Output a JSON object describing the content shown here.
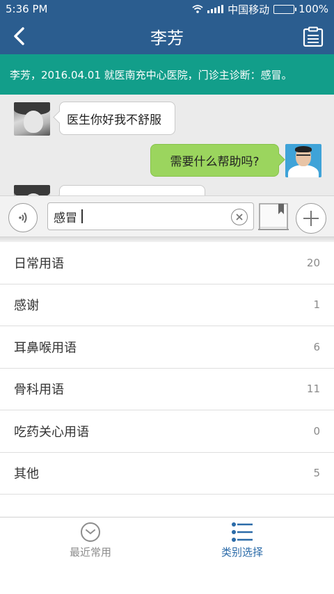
{
  "status_bar": {
    "time": "5:36 PM",
    "carrier": "中国移动",
    "battery": "100%"
  },
  "nav": {
    "title": "李芳"
  },
  "banner": {
    "text": "李芳，2016.04.01 就医南充中心医院，门诊主诊断：感冒。"
  },
  "chat": {
    "messages": [
      {
        "from": "patient",
        "text": "医生你好我不舒服"
      },
      {
        "from": "doctor",
        "text": "需要什么帮助吗?"
      },
      {
        "from": "patient",
        "text": ""
      }
    ]
  },
  "input": {
    "value": "感冒"
  },
  "categories": [
    {
      "label": "日常用语",
      "count": "20"
    },
    {
      "label": "感谢",
      "count": "1"
    },
    {
      "label": "耳鼻喉用语",
      "count": "6"
    },
    {
      "label": "骨科用语",
      "count": "11"
    },
    {
      "label": "吃药关心用语",
      "count": "0"
    },
    {
      "label": "其他",
      "count": "5"
    }
  ],
  "tabs": {
    "recent": "最近常用",
    "category": "类别选择"
  },
  "colors": {
    "header": "#2b5d8f",
    "banner": "#129e8a",
    "outgoing_bubble": "#9bd55e",
    "active_tab": "#2b6ba8"
  }
}
